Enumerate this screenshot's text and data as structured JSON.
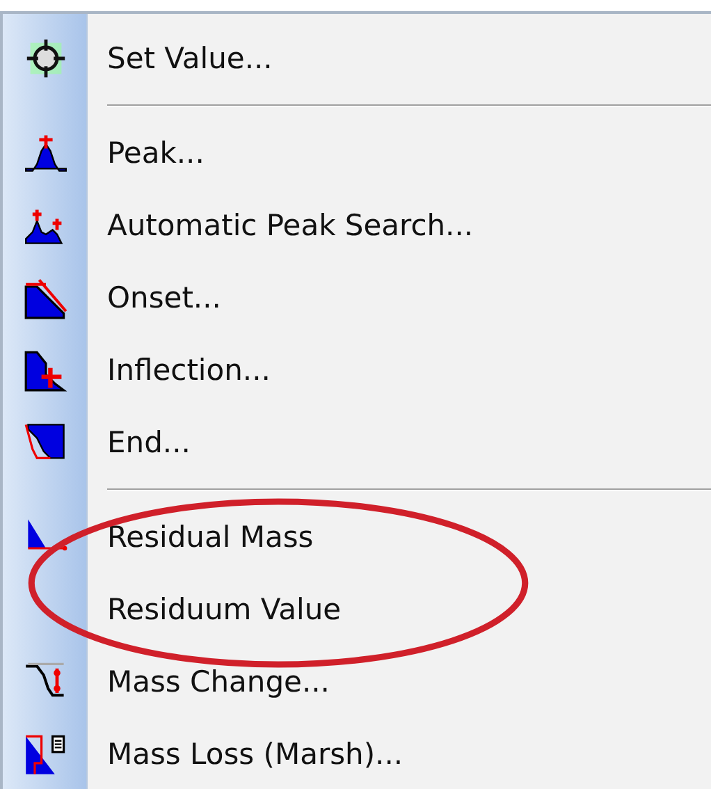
{
  "menu": {
    "items": [
      {
        "kind": "item",
        "label": "Set Value..."
      },
      {
        "kind": "separator"
      },
      {
        "kind": "item",
        "label": "Peak..."
      },
      {
        "kind": "item",
        "label": "Automatic Peak Search..."
      },
      {
        "kind": "item",
        "label": "Onset..."
      },
      {
        "kind": "item",
        "label": "Inflection..."
      },
      {
        "kind": "item",
        "label": "End..."
      },
      {
        "kind": "separator"
      },
      {
        "kind": "item",
        "label": "Residual Mass"
      },
      {
        "kind": "item",
        "label": "Residuum Value"
      },
      {
        "kind": "item",
        "label": "Mass Change..."
      },
      {
        "kind": "item",
        "label": "Mass Loss (Marsh)..."
      }
    ]
  }
}
